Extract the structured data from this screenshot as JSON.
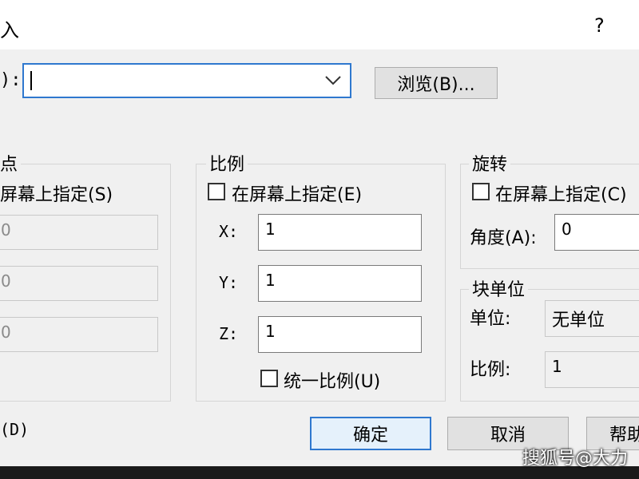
{
  "window": {
    "title_fragment": "入",
    "help_label": "?"
  },
  "name_row": {
    "label_fragment": "):",
    "browse_label": "浏览(B)..."
  },
  "insertion_group": {
    "title_fragment": "点",
    "on_screen_fragment": "屏幕上指定(S)",
    "fields": [
      "0",
      "0",
      "0"
    ]
  },
  "scale_group": {
    "title": "比例",
    "on_screen_label": "在屏幕上指定(E)",
    "x_label": "X:",
    "x_value": "1",
    "y_label": "Y:",
    "y_value": "1",
    "z_label": "Z:",
    "z_value": "1",
    "uniform_label": "统一比例(U)"
  },
  "rotation_group": {
    "title": "旋转",
    "on_screen_label": "在屏幕上指定(C)",
    "angle_label": "角度(A):",
    "angle_value": "0"
  },
  "block_unit_group": {
    "title": "块单位",
    "unit_label": "单位:",
    "unit_value": "无单位",
    "scale_label": "比例:",
    "scale_value": "1"
  },
  "bottom": {
    "explode_fragment": "(D)",
    "ok_label": "确定",
    "cancel_label": "取消",
    "help_label": "帮助"
  },
  "watermark": "搜狐号@大力"
}
